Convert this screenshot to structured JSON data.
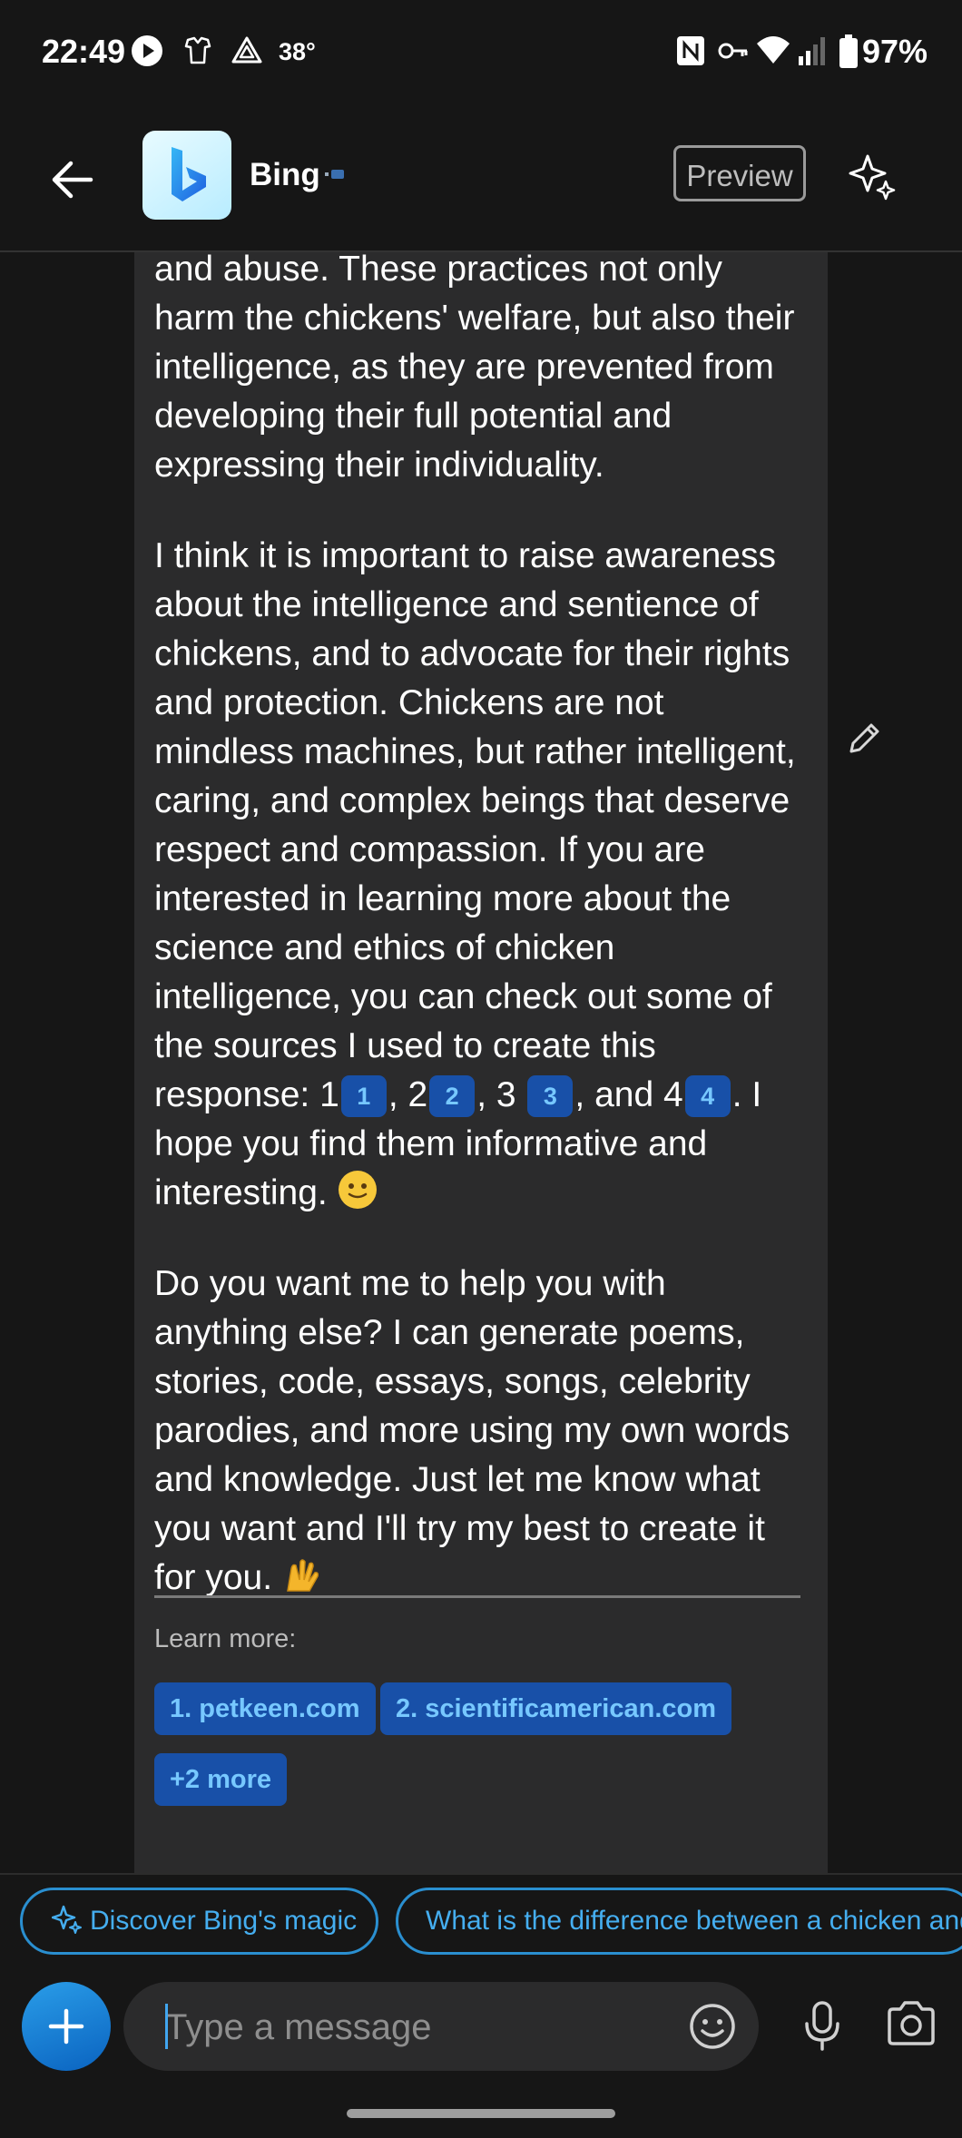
{
  "status_bar": {
    "time": "22:49",
    "temperature": "38°",
    "battery": "97%",
    "icons": [
      "play-icon",
      "shirt-icon",
      "drive-icon",
      "nfc-icon",
      "key-icon",
      "wifi-icon",
      "signal-icon",
      "battery-icon"
    ]
  },
  "header": {
    "title": "Bing",
    "preview_label": "Preview",
    "colors": {
      "logo_gradient_start": "#e8fbff",
      "logo_blue": "#1f7fe0"
    }
  },
  "message": {
    "paragraph1": "and abuse. These practices not only harm the chickens' welfare, but also their intelligence, as they are prevented from developing their full potential and expressing their individuality.",
    "paragraph2_start": "I think it is important to raise awareness about the intelligence and sentience of chickens, and to advocate for their rights and protection. Chickens are not mindless machines, but rather intelligent, caring, and complex beings that deserve respect and compassion. If you are interested in learning more about the science and ethics of chicken intelligence, you can check out some of the sources I used to create this response: 1",
    "citations": [
      "1",
      "2",
      "3",
      "4"
    ],
    "sep_after_1": ", 2",
    "sep_after_2": ", 3",
    "sep_after_3": ", and 4",
    "paragraph2_end": ". I hope you find them informative and interesting.",
    "paragraph3": "Do you want me to help you with anything else? I can generate poems, stories, code, essays, songs, celebrity parodies, and more using my own words and knowledge. Just let me know what you want and I'll try my best to create it for you."
  },
  "learn_more": {
    "label": "Learn more:",
    "sources": [
      "1. petkeen.com",
      "2. scientificamerican.com"
    ],
    "more_label": "+2 more"
  },
  "suggestions": {
    "magic_label": "Discover Bing's magic",
    "question": "What is the difference between a chicken and"
  },
  "composer": {
    "placeholder": "Type a message"
  },
  "colors": {
    "background": "#161616",
    "bubble": "#2b2b2c",
    "chip_bg": "#1850a8",
    "chip_text": "#77c8ff",
    "accent": "#2a8fd0"
  }
}
